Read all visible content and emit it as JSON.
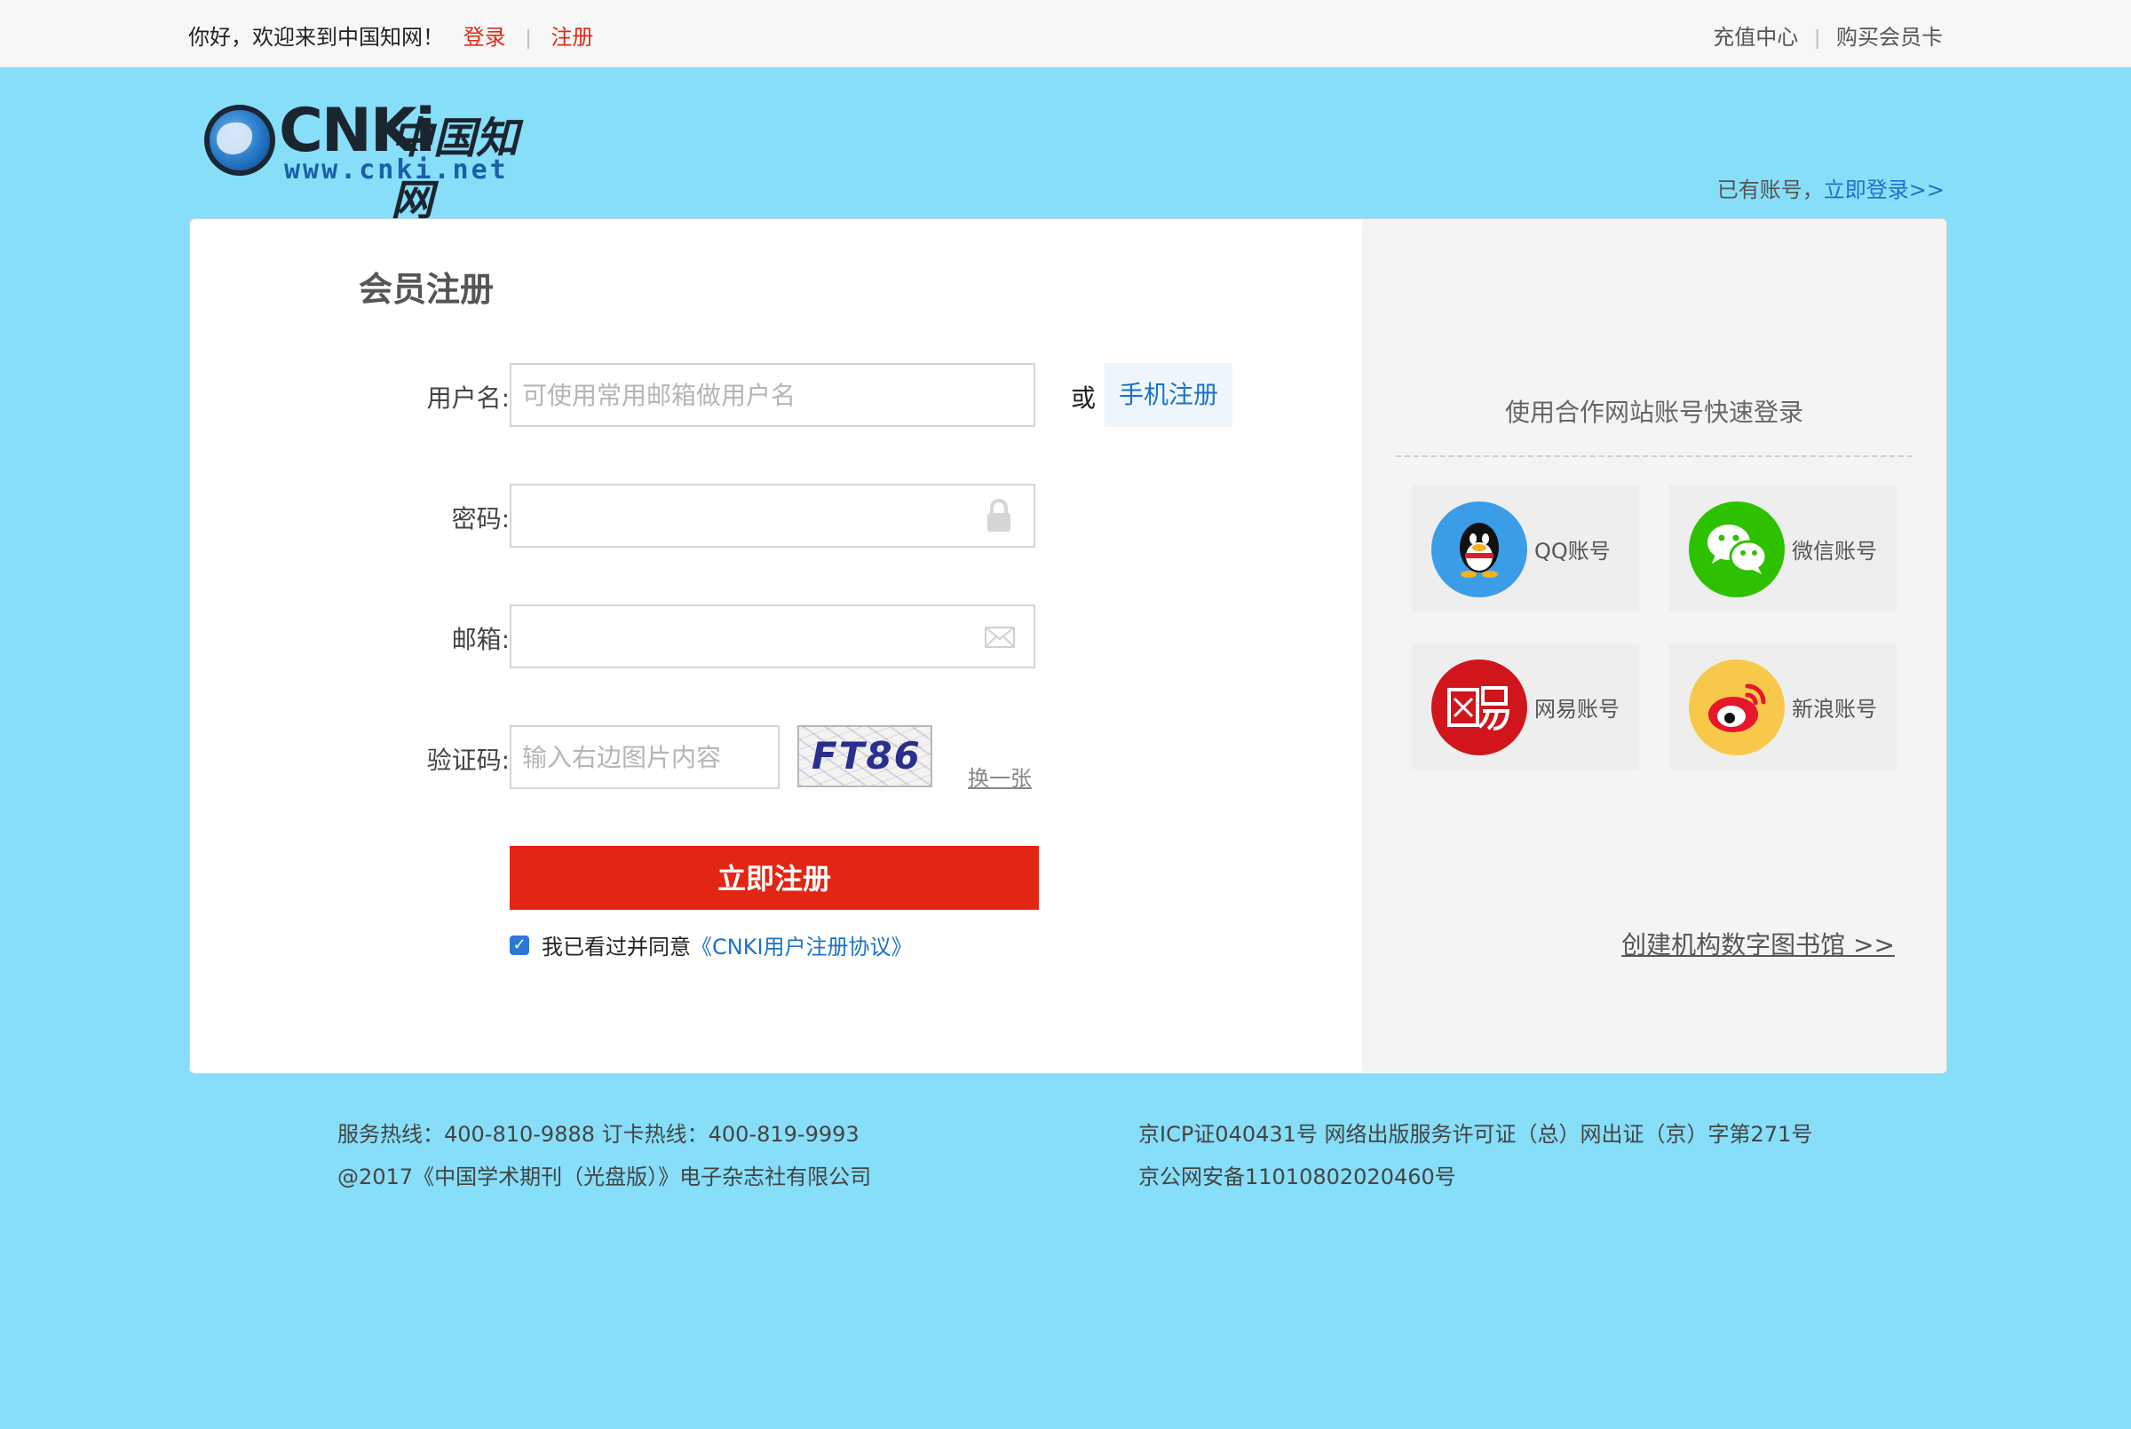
{
  "topbar": {
    "greeting": "你好，欢迎来到中国知网！",
    "login": "登录",
    "register": "注册",
    "separator": "|",
    "recharge": "充值中心",
    "buy_card": "购买会员卡"
  },
  "logo": {
    "brand": "CNKi",
    "brand_cn": "中国知网",
    "url": "www.cnki.net"
  },
  "have_account": {
    "text": "已有账号，",
    "link": "立即登录>>"
  },
  "form": {
    "title": "会员注册",
    "username_label": "用户名:",
    "username_placeholder": "可使用常用邮箱做用户名",
    "or_text": "或",
    "phone_register": "手机注册",
    "password_label": "密码:",
    "email_label": "邮箱:",
    "captcha_label": "验证码:",
    "captcha_placeholder": "输入右边图片内容",
    "captcha_text": "FT86",
    "refresh": "换一张",
    "submit": "立即注册",
    "agree_text": "我已看过并同意",
    "agreement_link": "《CNKI用户注册协议》",
    "agree_checked": true
  },
  "side": {
    "title": "使用合作网站账号快速登录",
    "accounts": [
      {
        "label": "QQ账号",
        "icon": "qq-icon",
        "color": "#3b9de8"
      },
      {
        "label": "微信账号",
        "icon": "wechat-icon",
        "color": "#2dc100"
      },
      {
        "label": "网易账号",
        "icon": "netease-icon",
        "color": "#d0161c"
      },
      {
        "label": "新浪账号",
        "icon": "weibo-icon",
        "color": "#f7c84a"
      }
    ],
    "library_link": "创建机构数字图书馆 >>"
  },
  "footer": {
    "hotline": "服务热线：400-810-9888  订卡热线：400-819-9993",
    "copyright": "@2017《中国学术期刊（光盘版）》电子杂志社有限公司",
    "icp": "京ICP证040431号 网络出版服务许可证（总）网出证（京）字第271号",
    "police": "京公网安备11010802020460号"
  }
}
